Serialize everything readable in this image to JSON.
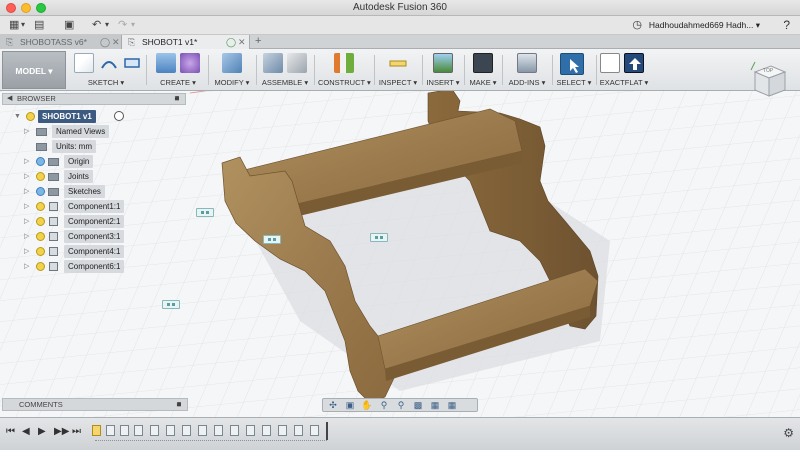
{
  "window": {
    "title": "Autodesk Fusion 360"
  },
  "quick_access": {
    "user": "Hadhoudahmed669 Hadh... ▾",
    "help": "?",
    "icons": [
      "grid-menu-icon",
      "save-icon",
      "undo-icon",
      "redo-icon",
      "clock-icon"
    ]
  },
  "tabs": [
    {
      "label": "SHOBOTASS v6*",
      "active": false
    },
    {
      "label": "SHOBOT1 v1*",
      "active": true
    }
  ],
  "toolbar": {
    "workspace": "MODEL ▾",
    "groups": [
      {
        "label": "SKETCH ▾"
      },
      {
        "label": "CREATE ▾"
      },
      {
        "label": "MODIFY ▾"
      },
      {
        "label": "ASSEMBLE ▾"
      },
      {
        "label": "CONSTRUCT ▾"
      },
      {
        "label": "INSPECT ▾"
      },
      {
        "label": "INSERT ▾"
      },
      {
        "label": "MAKE ▾"
      },
      {
        "label": "ADD-INS ▾"
      },
      {
        "label": "SELECT ▾"
      },
      {
        "label": "EXACTFLAT ▾"
      }
    ]
  },
  "browser": {
    "title": "BROWSER",
    "root": "SHOBOT1 v1",
    "items": [
      {
        "label": "Named Views"
      },
      {
        "label": "Units: mm"
      },
      {
        "label": "Origin"
      },
      {
        "label": "Joints"
      },
      {
        "label": "Sketches"
      },
      {
        "label": "Component1:1"
      },
      {
        "label": "Component2:1"
      },
      {
        "label": "Component3:1"
      },
      {
        "label": "Component4:1"
      },
      {
        "label": "Component6:1"
      }
    ]
  },
  "comments": {
    "title": "COMMENTS"
  },
  "viewcube": {
    "face_label": "TOP"
  },
  "colors": {
    "wood": "#9c7c4e",
    "wood_dark": "#7a5c34",
    "grid": "#dfe2e5",
    "accent_blue": "#3d5a80"
  }
}
